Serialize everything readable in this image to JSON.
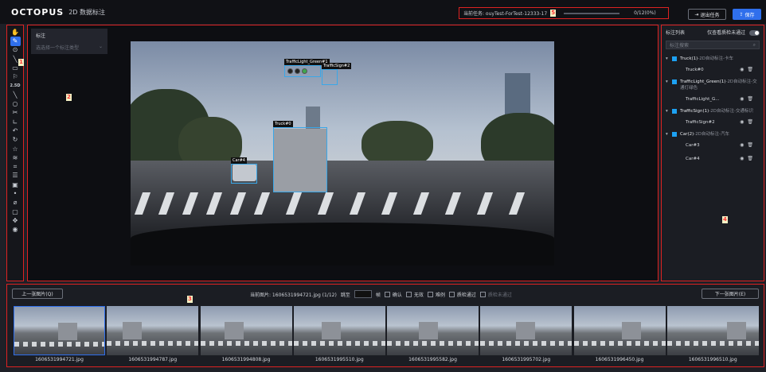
{
  "header": {
    "logo": "OCTOPUS",
    "subtitle": "2D 数据标注",
    "task_label": "当前任务: ouyTest-ForTest-12333-17",
    "task_progress_text": "0/12(0%)",
    "task_progress_fraction": 0.0,
    "exit_label": "退出任务",
    "save_label": "保存",
    "region_number": "5"
  },
  "toolbar": {
    "region_number": "1",
    "tools": [
      "hand-icon",
      "edit-icon",
      "point-icon",
      "line-icon",
      "rectangle-icon",
      "flag-icon",
      "2.5D",
      "line-tool-icon",
      "circle-icon",
      "scissors-icon",
      "angle-icon",
      "undo-icon",
      "rotate-icon",
      "star-icon",
      "layers-icon",
      "crop-icon",
      "list-icon",
      "image-icon",
      "dot-icon",
      "tag-icon",
      "screen-icon",
      "move-icon",
      "eye-icon"
    ]
  },
  "canvas": {
    "region_number": "2",
    "panel_title": "标注",
    "select_placeholder": "选选择一个标注类型",
    "labels": {
      "truck": "Truck#0",
      "car": "Car#4",
      "light": "TrafficLight_Green#1",
      "sign": "TrafficSign#2"
    }
  },
  "right_panel": {
    "region_number": "4",
    "title": "标注列表",
    "toggle_label": "仅查看质检未通过",
    "search_placeholder": "标注搜索",
    "groups": [
      {
        "title": "Truck(1)",
        "sub": "-2D自动标注-卡车",
        "items": [
          "Truck#0"
        ]
      },
      {
        "title": "TrafficLight_Green(1)",
        "sub": "-2D自动标注-交通灯绿色",
        "items": [
          "TrafficLight_G..."
        ]
      },
      {
        "title": "TrafficSign(1)",
        "sub": "-2D自动标注-交通标识",
        "items": [
          "TrafficSign#2"
        ]
      },
      {
        "title": "Car(2)",
        "sub": "-2D自动标注-汽车",
        "items": [
          "Car#3",
          "Car#4"
        ]
      }
    ]
  },
  "bottom": {
    "region_number": "3",
    "prev_label": "上一张图片(Q)",
    "next_label": "下一张图片(E)",
    "current_image": "当前图片: 1606531994721.jpg (1/12)",
    "jump_label": "跳至",
    "frame_label": "帧",
    "checks": [
      "确认",
      "无效",
      "难例",
      "质检通过",
      "质检未通过"
    ],
    "thumbnails": [
      "1606531994721.jpg",
      "1606531994787.jpg",
      "1606531994808.jpg",
      "1606531995510.jpg",
      "1606531995582.jpg",
      "1606531995702.jpg",
      "1606531996450.jpg",
      "1606531996510.jpg"
    ]
  },
  "colors": {
    "accent": "#2f6fec",
    "bbox": "#3aa7e8",
    "region_outline": "#dd2222"
  }
}
